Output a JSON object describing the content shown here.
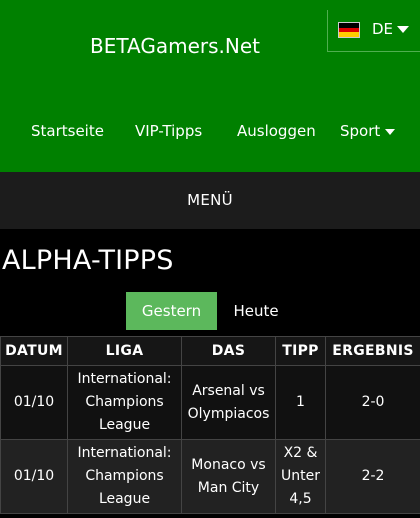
{
  "site": {
    "title": "BETAGamers.Net"
  },
  "language": {
    "code": "DE",
    "flag_colors": [
      "#000000",
      "#dd0000",
      "#ffce00"
    ]
  },
  "nav": {
    "items": [
      {
        "label": "Startseite"
      },
      {
        "label": "VIP-Tipps"
      },
      {
        "label": "Ausloggen"
      },
      {
        "label": "Sport"
      }
    ]
  },
  "menu": {
    "label": "MENÜ"
  },
  "page": {
    "title": "ALPHA-TIPPS"
  },
  "tabs": [
    {
      "label": "Gestern",
      "active": true
    },
    {
      "label": "Heute",
      "active": false
    }
  ],
  "table": {
    "headers": [
      "DATUM",
      "LIGA",
      "DAS",
      "TIPP",
      "ERGEBNIS"
    ],
    "rows": [
      {
        "date": "01/10",
        "league": "International: Champions League",
        "match": "Arsenal vs Olympiacos",
        "tip": "1",
        "result": "2-0"
      },
      {
        "date": "01/10",
        "league": "International: Champions League",
        "match": "Monaco vs Man City",
        "tip": "X2 & Unter 4,5",
        "result": "2-2"
      }
    ]
  },
  "colors": {
    "header_green": "#008000",
    "active_tab_green": "#5cb85c",
    "menu_bar": "#1c1c1c",
    "background": "#000000"
  }
}
